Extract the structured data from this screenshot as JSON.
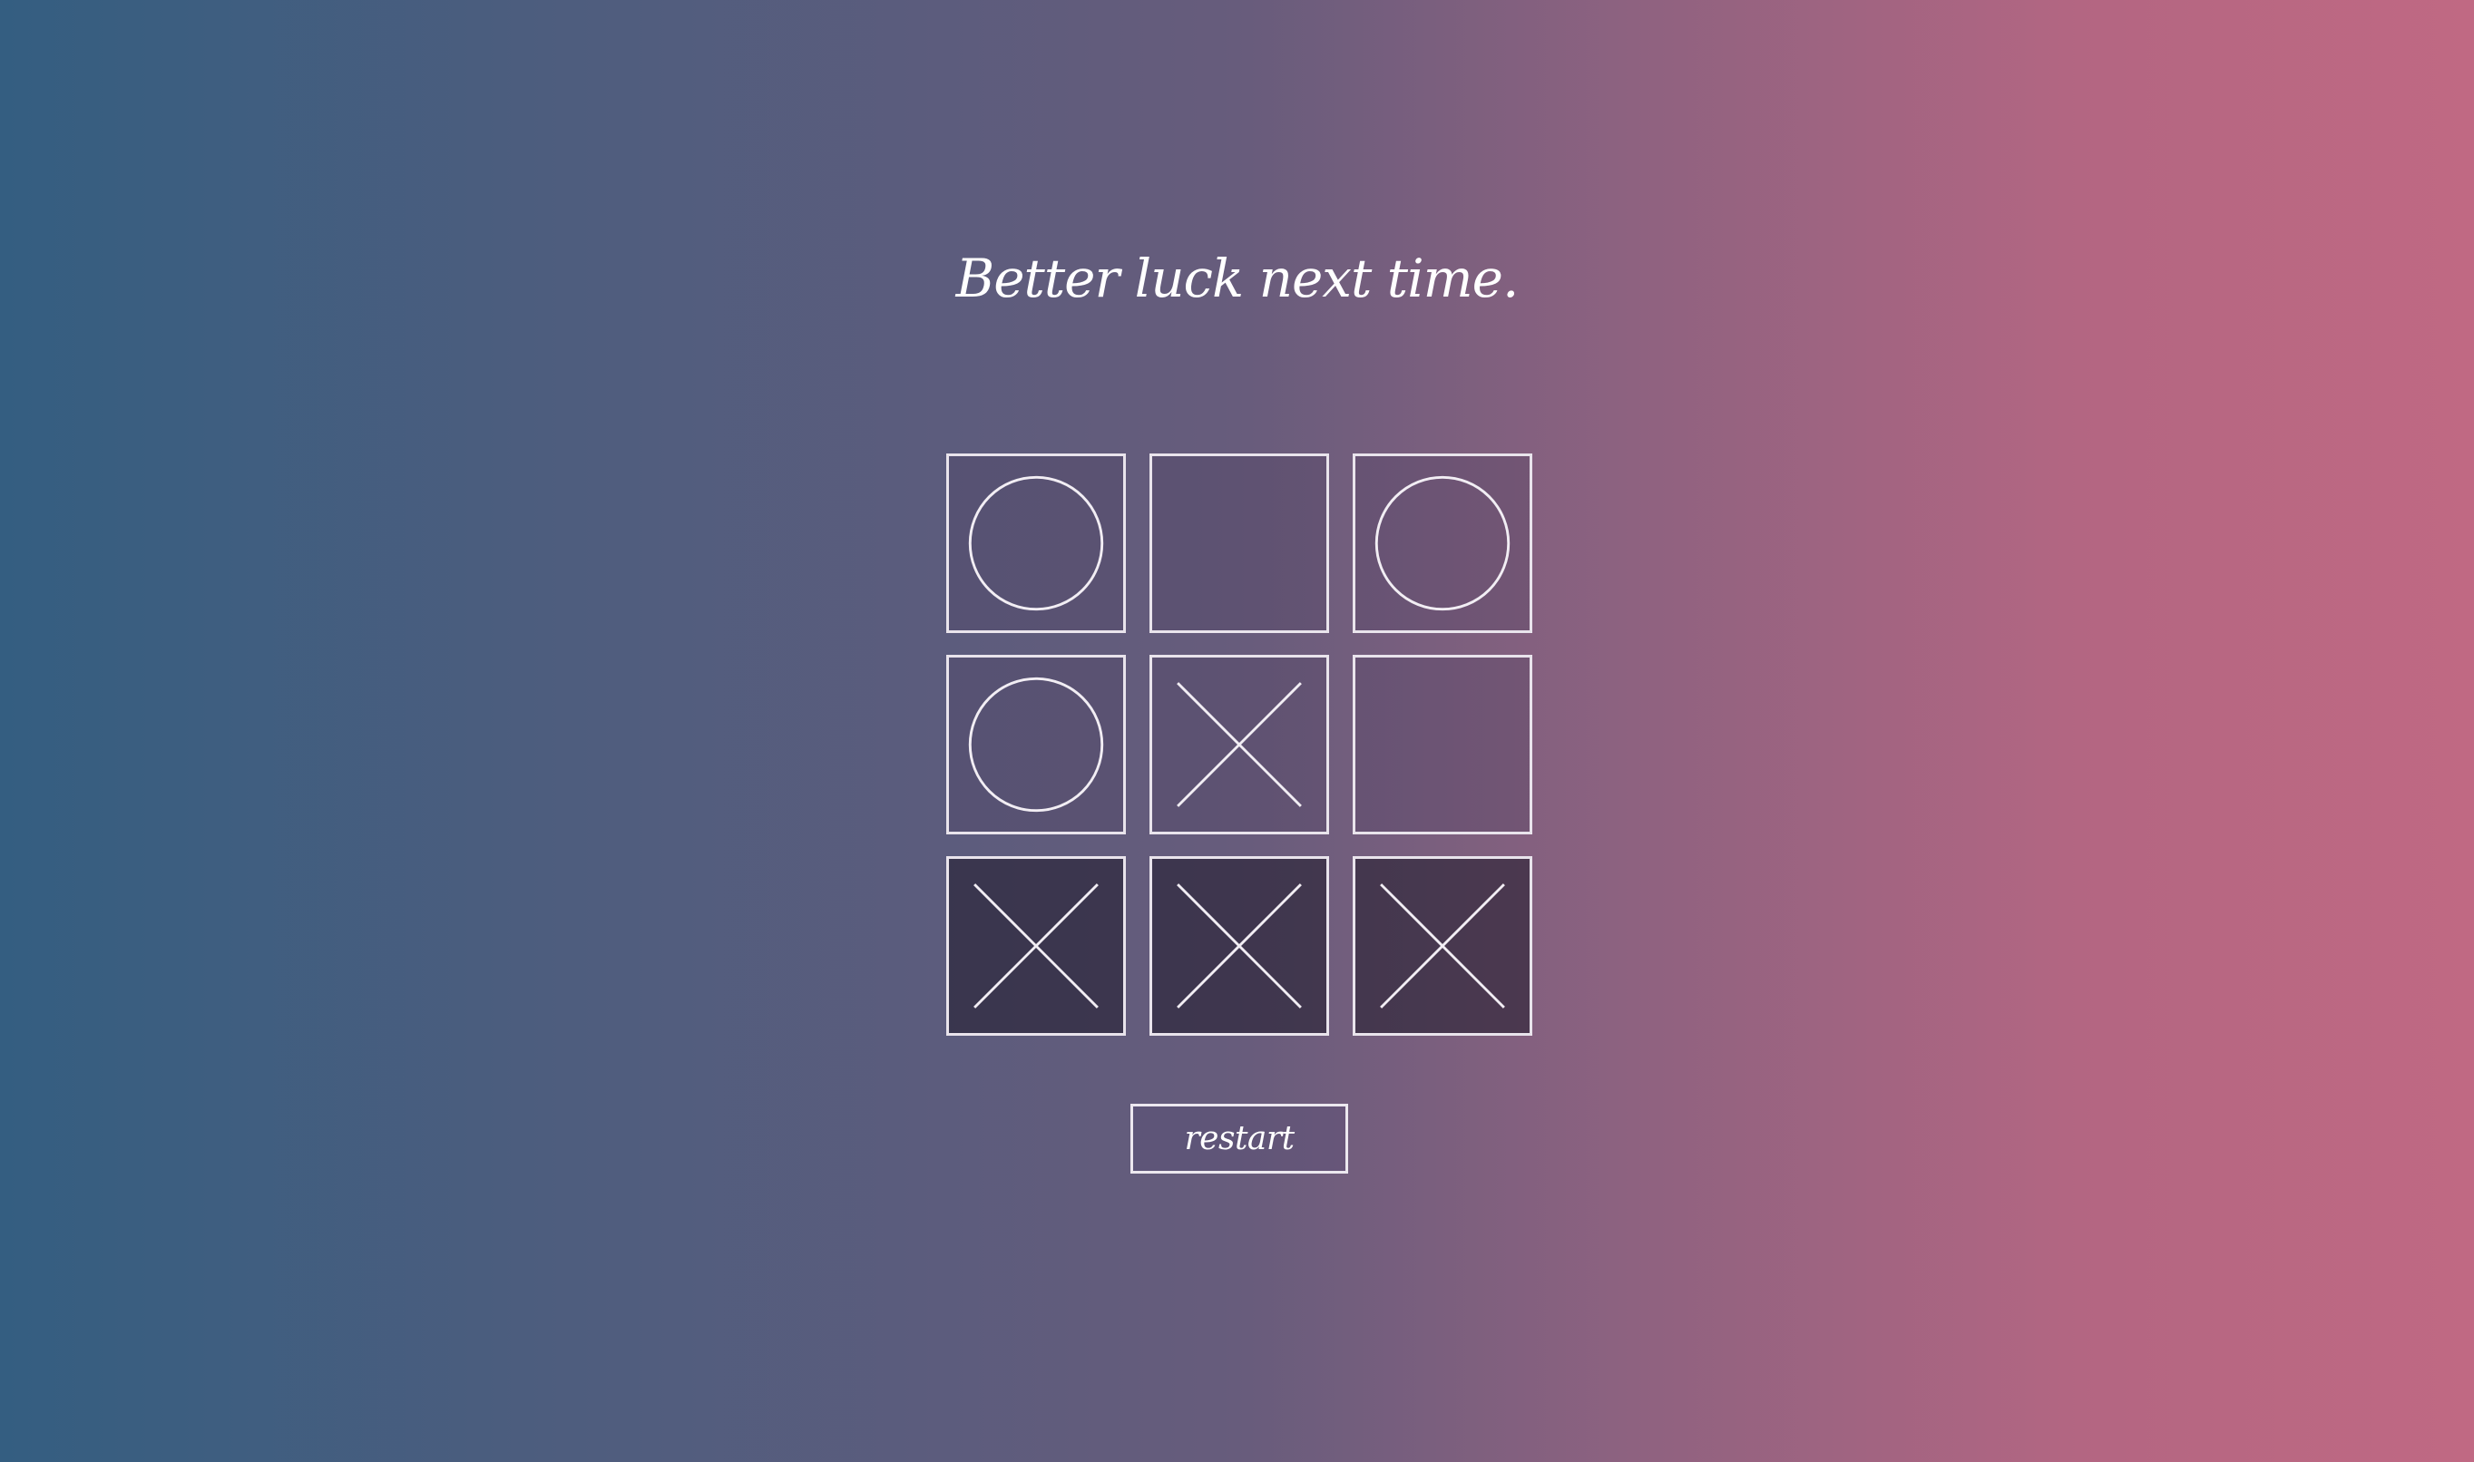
{
  "message": "Better luck next time.",
  "restart_label": "restart",
  "board": {
    "cells": [
      "O",
      "",
      "O",
      "O",
      "X",
      "",
      "X",
      "X",
      "X"
    ],
    "winning_cells": [
      6,
      7,
      8
    ]
  },
  "colors": {
    "gradient_left": "#345e81",
    "gradient_mid": "#675c7c",
    "gradient_right": "#c06983",
    "line": "#f2eef4"
  },
  "icons": {
    "X": "cross-icon",
    "O": "circle-icon"
  }
}
